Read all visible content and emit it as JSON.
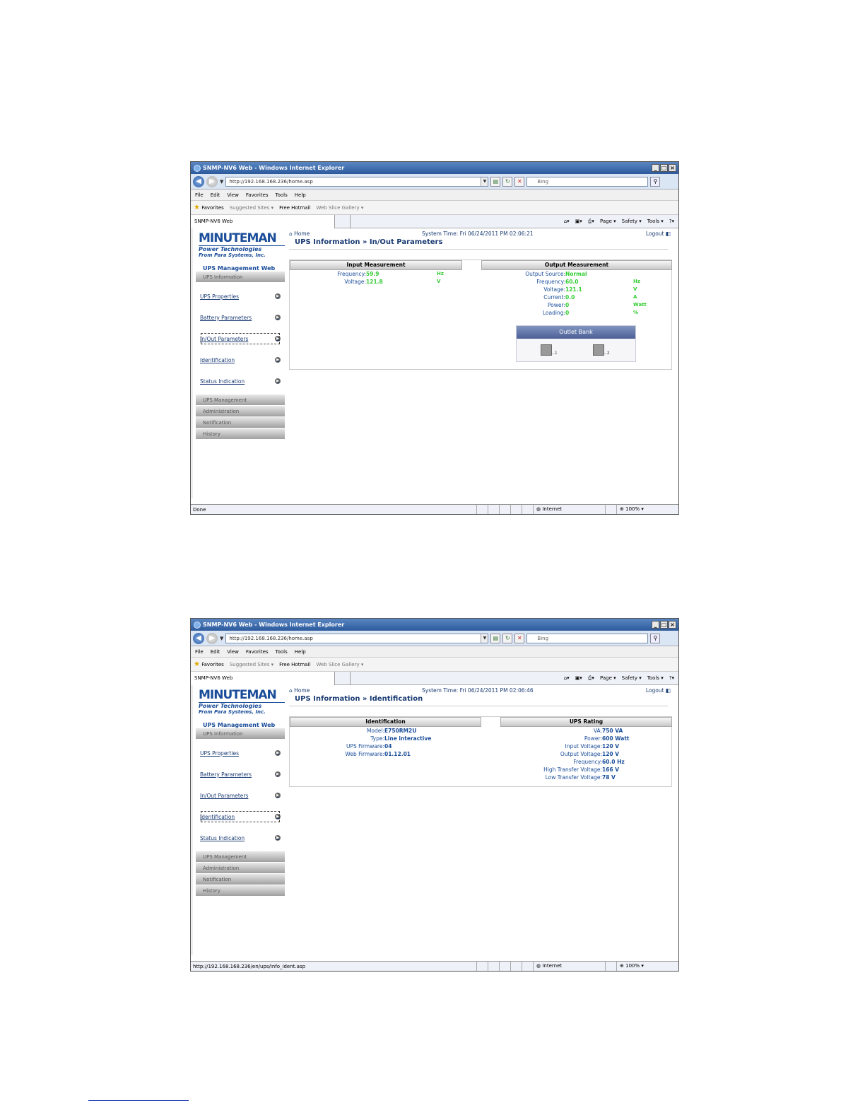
{
  "screens": [
    {
      "window_title": "SNMP-NV6 Web - Windows Internet Explorer",
      "url_host": "http://192.168.168.236",
      "url_path": "/home.asp",
      "search_placeholder": "Bing",
      "tab_title": "SNMP-NV6 Web",
      "status_text": "Done",
      "page_title": "UPS Information » In/Out Parameters",
      "system_time": "System Time: Fri 06/24/2011 PM 02:06:21",
      "active_nav": "In/Out Parameters"
    },
    {
      "window_title": "SNMP-NV6 Web - Windows Internet Explorer",
      "url_host": "http://192.168.168.236",
      "url_path": "/home.asp",
      "search_placeholder": "Bing",
      "tab_title": "SNMP-NV6 Web",
      "status_text": "http://192.168.168.236/en/ups/info_ident.asp",
      "page_title": "UPS Information » Identification",
      "system_time": "System Time: Fri 06/24/2011 PM 02:06:46",
      "active_nav": "Identification"
    }
  ],
  "browser": {
    "menu": [
      "File",
      "Edit",
      "View",
      "Favorites",
      "Tools",
      "Help"
    ],
    "favorites": "Favorites",
    "suggested_sites": "Suggested Sites ▾",
    "free_hotmail": "Free Hotmail",
    "web_slice_gallery": "Web Slice Gallery ▾",
    "cmd_page": "Page ▾",
    "cmd_safety": "Safety ▾",
    "cmd_tools": "Tools ▾",
    "zone": "Internet",
    "zoom": "100%"
  },
  "sidebar": {
    "logo_brand": "MINUTEMAN",
    "logo_tagline": "Power Technologies",
    "logo_sub": "From Para Systems, Inc.",
    "app_name": "UPS Management Web",
    "section_ups_info": "UPS Information",
    "nav": [
      "UPS Properties",
      "Battery Parameters",
      "In/Out Parameters",
      "Identification",
      "Status Indication"
    ],
    "section_ups_mgmt": "UPS Management",
    "section_admin": "Administration",
    "section_notification": "Notification",
    "section_history": "History"
  },
  "common": {
    "home": "Home",
    "logout": "Logout"
  },
  "inout": {
    "input_header": "Input Measurement",
    "output_header": "Output Measurement",
    "input": [
      {
        "label": "Frequency:",
        "value": "59.9",
        "unit": "Hz"
      },
      {
        "label": "Voltage:",
        "value": "121.8",
        "unit": "V"
      }
    ],
    "output_source_label": "Output Source:",
    "output_source_value": "Normal",
    "output": [
      {
        "label": "Frequency:",
        "value": "60.0",
        "unit": "Hz"
      },
      {
        "label": "Voltage:",
        "value": "121.1",
        "unit": "V"
      },
      {
        "label": "Current:",
        "value": "0.0",
        "unit": "A"
      },
      {
        "label": "Power:",
        "value": "0",
        "unit": "Watt"
      },
      {
        "label": "Loading:",
        "value": "0",
        "unit": "%"
      }
    ],
    "outlet_bank_title": "Outlet Bank",
    "outlet1": "..1",
    "outlet2": "..2"
  },
  "ident": {
    "id_header": "Identification",
    "rating_header": "UPS Rating",
    "id_rows": [
      {
        "label": "Model:",
        "value": "E750RM2U"
      },
      {
        "label": "Type:",
        "value": "Line interactive"
      },
      {
        "label": "UPS Firmware:",
        "value": "04"
      },
      {
        "label": "Web Firmware:",
        "value": "01.12.01"
      }
    ],
    "rating_rows": [
      {
        "label": "VA:",
        "value": "750 VA"
      },
      {
        "label": "Power:",
        "value": "600 Watt"
      },
      {
        "label": "Input Voltage:",
        "value": "120 V"
      },
      {
        "label": "Output Voltage:",
        "value": "120 V"
      },
      {
        "label": "Frequency:",
        "value": "60.0 Hz"
      },
      {
        "label": "High Transfer Voltage:",
        "value": "166 V"
      },
      {
        "label": "Low Transfer Voltage:",
        "value": "78 V"
      }
    ]
  },
  "colors": {
    "link_blue": "#1a3b73",
    "value_green": "#33cc33",
    "ident_blue": "#1a4d99"
  }
}
